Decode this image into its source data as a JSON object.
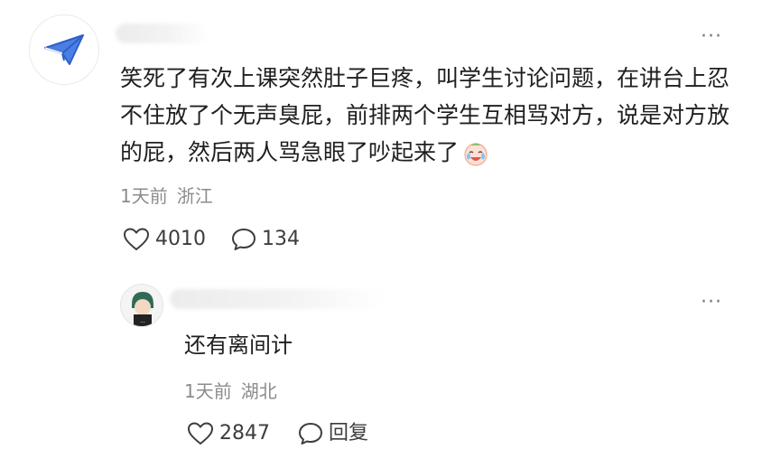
{
  "comment": {
    "text": "笑死了有次上课突然肚子巨疼，叫学生讨论问题，在讲台上忍不住放了个无声臭屁，前排两个学生互相骂对方，说是对方放的屁，然后两人骂急眼了吵起来了",
    "emoji_icon": "laughing-crying-emoji-icon",
    "time": "1天前",
    "location": "浙江",
    "likes": "4010",
    "comments": "134",
    "more_label": "···"
  },
  "reply": {
    "text": "还有离间计",
    "time": "1天前",
    "location": "湖北",
    "likes": "2847",
    "reply_label": "回复",
    "more_label": "···"
  },
  "colors": {
    "accent_blue": "#4a7fe6",
    "meta_gray": "#8c8c8c",
    "icon_gray": "#3d3d3d"
  }
}
